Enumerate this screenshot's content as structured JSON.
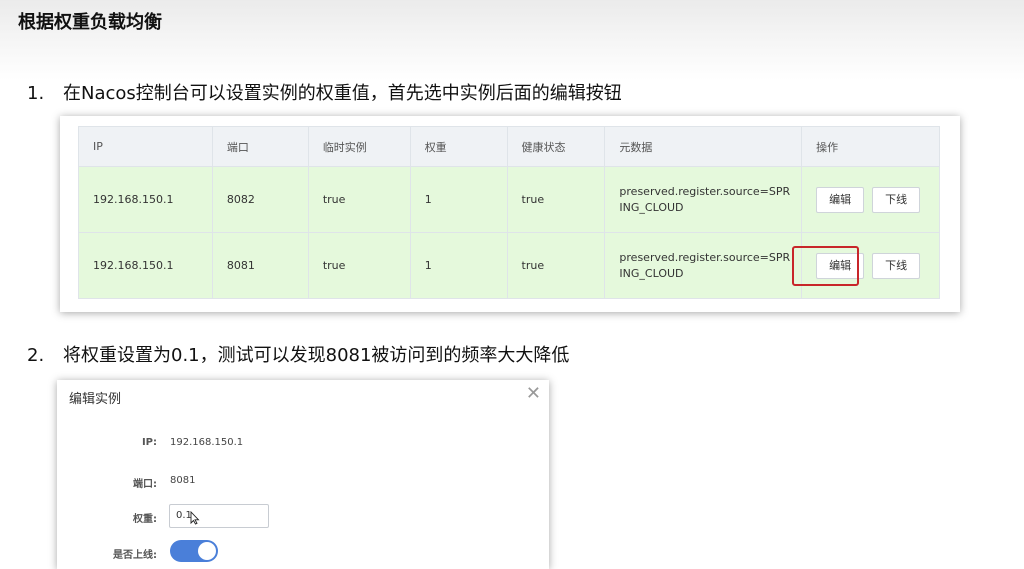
{
  "slide": {
    "title": "根据权重负载均衡",
    "steps": [
      {
        "number": "1.",
        "text": "在Nacos控制台可以设置实例的权重值，首先选中实例后面的编辑按钮"
      },
      {
        "number": "2.",
        "text": "将权重设置为0.1，测试可以发现8081被访问到的频率大大降低"
      }
    ]
  },
  "instance_table": {
    "headers": [
      "IP",
      "端口",
      "临时实例",
      "权重",
      "健康状态",
      "元数据",
      "操作"
    ],
    "rows": [
      {
        "ip": "192.168.150.1",
        "port": "8082",
        "ephemeral": "true",
        "weight": "1",
        "healthy": "true",
        "metadata": "preserved.register.source=SPRING_CLOUD",
        "edit_label": "编辑",
        "offline_label": "下线"
      },
      {
        "ip": "192.168.150.1",
        "port": "8081",
        "ephemeral": "true",
        "weight": "1",
        "healthy": "true",
        "metadata": "preserved.register.source=SPRING_CLOUD",
        "edit_label": "编辑",
        "offline_label": "下线"
      }
    ],
    "highlight_color": "#c8262a"
  },
  "edit_dialog": {
    "title": "编辑实例",
    "close_icon": "close-icon",
    "fields": {
      "ip_label": "IP:",
      "ip_value": "192.168.150.1",
      "port_label": "端口:",
      "port_value": "8081",
      "weight_label": "权重:",
      "weight_value": "0.1",
      "online_label": "是否上线:"
    },
    "online_enabled": true,
    "toggle_color": "#4a7fd9"
  }
}
